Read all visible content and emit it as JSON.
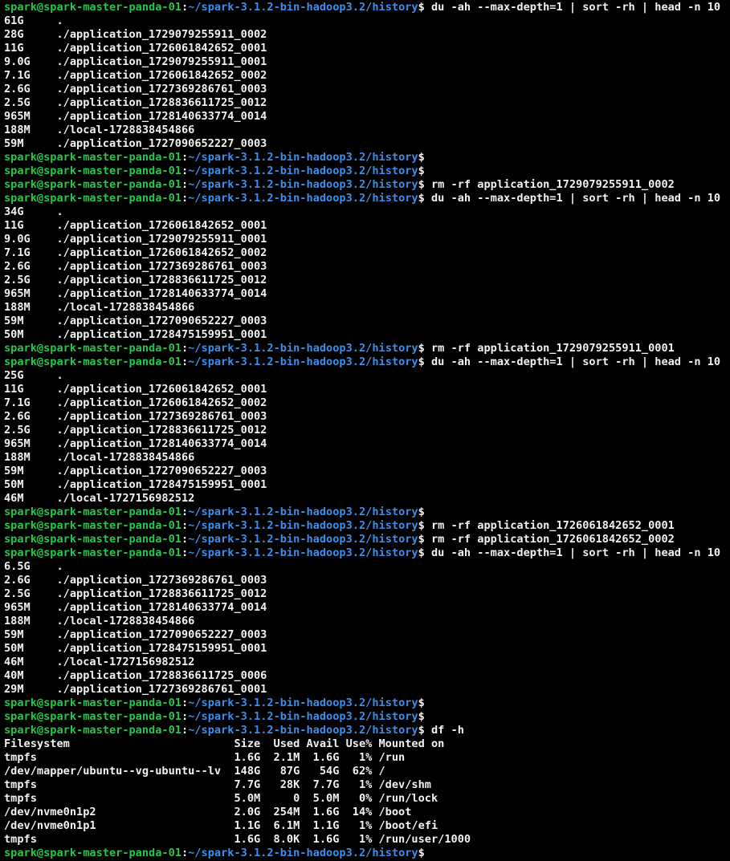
{
  "prompt": {
    "user_host": "spark@spark-master-panda-01",
    "path": "~/spark-3.1.2-bin-hadoop3.2/history",
    "sep": ":",
    "dollar": "$"
  },
  "colors": {
    "background": "#000000",
    "user_host": "#26c64b",
    "path": "#3b8eea",
    "text": "#f2f2f2"
  },
  "lines": [
    {
      "t": "p",
      "cmd": " du -ah --max-depth=1 | sort -rh | head -n 10"
    },
    {
      "t": "o",
      "text": "61G     ."
    },
    {
      "t": "o",
      "text": "28G     ./application_1729079255911_0002"
    },
    {
      "t": "o",
      "text": "11G     ./application_1726061842652_0001"
    },
    {
      "t": "o",
      "text": "9.0G    ./application_1729079255911_0001"
    },
    {
      "t": "o",
      "text": "7.1G    ./application_1726061842652_0002"
    },
    {
      "t": "o",
      "text": "2.6G    ./application_1727369286761_0003"
    },
    {
      "t": "o",
      "text": "2.5G    ./application_1728836611725_0012"
    },
    {
      "t": "o",
      "text": "965M    ./application_1728140633774_0014"
    },
    {
      "t": "o",
      "text": "188M    ./local-1728838454866"
    },
    {
      "t": "o",
      "text": "59M     ./application_1727090652227_0003"
    },
    {
      "t": "p",
      "cmd": ""
    },
    {
      "t": "p",
      "cmd": ""
    },
    {
      "t": "p",
      "cmd": " rm -rf application_1729079255911_0002"
    },
    {
      "t": "p",
      "cmd": " du -ah --max-depth=1 | sort -rh | head -n 10"
    },
    {
      "t": "o",
      "text": "34G     ."
    },
    {
      "t": "o",
      "text": "11G     ./application_1726061842652_0001"
    },
    {
      "t": "o",
      "text": "9.0G    ./application_1729079255911_0001"
    },
    {
      "t": "o",
      "text": "7.1G    ./application_1726061842652_0002"
    },
    {
      "t": "o",
      "text": "2.6G    ./application_1727369286761_0003"
    },
    {
      "t": "o",
      "text": "2.5G    ./application_1728836611725_0012"
    },
    {
      "t": "o",
      "text": "965M    ./application_1728140633774_0014"
    },
    {
      "t": "o",
      "text": "188M    ./local-1728838454866"
    },
    {
      "t": "o",
      "text": "59M     ./application_1727090652227_0003"
    },
    {
      "t": "o",
      "text": "50M     ./application_1728475159951_0001"
    },
    {
      "t": "p",
      "cmd": " rm -rf application_1729079255911_0001"
    },
    {
      "t": "p",
      "cmd": " du -ah --max-depth=1 | sort -rh | head -n 10"
    },
    {
      "t": "o",
      "text": "25G     ."
    },
    {
      "t": "o",
      "text": "11G     ./application_1726061842652_0001"
    },
    {
      "t": "o",
      "text": "7.1G    ./application_1726061842652_0002"
    },
    {
      "t": "o",
      "text": "2.6G    ./application_1727369286761_0003"
    },
    {
      "t": "o",
      "text": "2.5G    ./application_1728836611725_0012"
    },
    {
      "t": "o",
      "text": "965M    ./application_1728140633774_0014"
    },
    {
      "t": "o",
      "text": "188M    ./local-1728838454866"
    },
    {
      "t": "o",
      "text": "59M     ./application_1727090652227_0003"
    },
    {
      "t": "o",
      "text": "50M     ./application_1728475159951_0001"
    },
    {
      "t": "o",
      "text": "46M     ./local-1727156982512"
    },
    {
      "t": "p",
      "cmd": ""
    },
    {
      "t": "p",
      "cmd": " rm -rf application_1726061842652_0001"
    },
    {
      "t": "p",
      "cmd": " rm -rf application_1726061842652_0002"
    },
    {
      "t": "p",
      "cmd": " du -ah --max-depth=1 | sort -rh | head -n 10"
    },
    {
      "t": "o",
      "text": "6.5G    ."
    },
    {
      "t": "o",
      "text": "2.6G    ./application_1727369286761_0003"
    },
    {
      "t": "o",
      "text": "2.5G    ./application_1728836611725_0012"
    },
    {
      "t": "o",
      "text": "965M    ./application_1728140633774_0014"
    },
    {
      "t": "o",
      "text": "188M    ./local-1728838454866"
    },
    {
      "t": "o",
      "text": "59M     ./application_1727090652227_0003"
    },
    {
      "t": "o",
      "text": "50M     ./application_1728475159951_0001"
    },
    {
      "t": "o",
      "text": "46M     ./local-1727156982512"
    },
    {
      "t": "o",
      "text": "40M     ./application_1728836611725_0006"
    },
    {
      "t": "o",
      "text": "29M     ./application_1727369286761_0001"
    },
    {
      "t": "p",
      "cmd": ""
    },
    {
      "t": "p",
      "cmd": ""
    },
    {
      "t": "p",
      "cmd": " df -h"
    },
    {
      "t": "o",
      "text": "Filesystem                         Size  Used Avail Use% Mounted on"
    },
    {
      "t": "o",
      "text": "tmpfs                              1.6G  2.1M  1.6G   1% /run"
    },
    {
      "t": "o",
      "text": "/dev/mapper/ubuntu--vg-ubuntu--lv  148G   87G   54G  62% /"
    },
    {
      "t": "o",
      "text": "tmpfs                              7.7G   28K  7.7G   1% /dev/shm"
    },
    {
      "t": "o",
      "text": "tmpfs                              5.0M     0  5.0M   0% /run/lock"
    },
    {
      "t": "o",
      "text": "/dev/nvme0n1p2                     2.0G  254M  1.6G  14% /boot"
    },
    {
      "t": "o",
      "text": "/dev/nvme0n1p1                     1.1G  6.1M  1.1G   1% /boot/efi"
    },
    {
      "t": "o",
      "text": "tmpfs                              1.6G  8.0K  1.6G   1% /run/user/1000"
    },
    {
      "t": "p",
      "cmd": ""
    }
  ]
}
